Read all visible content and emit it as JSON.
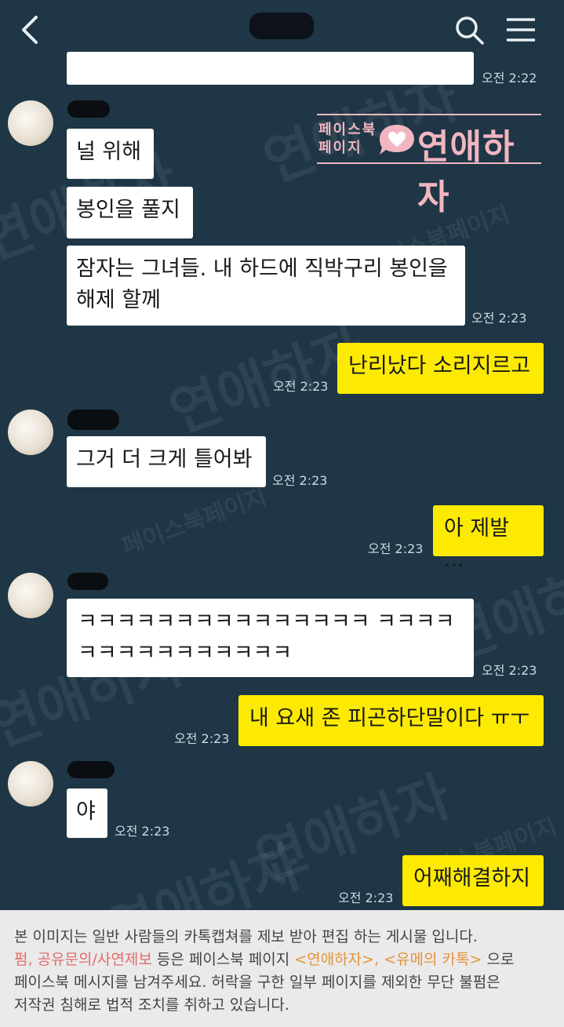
{
  "watermark": {
    "brand": "연애하자",
    "page_label": "페이스북페이지"
  },
  "topbar": {
    "back_icon": "chevron-left-icon",
    "search_icon": "search-icon",
    "menu_icon": "hamburger-icon"
  },
  "logo": {
    "top": "페이스북",
    "bottom": "페이지",
    "brand": "연애하자"
  },
  "messages": [
    {
      "time": "오전 2:22"
    },
    {
      "text": "널 위해"
    },
    {
      "text": "봉인을 풀지"
    },
    {
      "line1": "잠자는 그녀들. 내 하드에 직박구리 봉인을",
      "line2": "해제 할께",
      "time": "오전 2:23"
    },
    {
      "text": "난리났다 소리지르고",
      "time": "오전 2:23"
    },
    {
      "text": "그거 더 크게 틀어봐",
      "time": "오전 2:23"
    },
    {
      "text": "아 제발 ...",
      "time": "오전 2:23"
    },
    {
      "line1": "ㅋㅋㅋㅋㅋㅋㅋㅋㅋㅋㅋㅋㅋㅋㅋ ㅋㅋㅋㅋ",
      "line2": "ㅋㅋㅋㅋㅋㅋㅋㅋㅋㅋㅋ",
      "time": "오전 2:23"
    },
    {
      "text": "내 요새 존 피곤하단말이다 ㅠㅜ",
      "time": "오전 2:23"
    },
    {
      "text": "야",
      "time": "오전 2:23"
    },
    {
      "text": "어째해결하지",
      "time": "오전 2:23"
    }
  ],
  "footer": {
    "l1": "본 이미지는 일반 사람들의 카톡캡쳐를 제보 받아 편집 하는 게시물 입니다.",
    "l2a": "펌, 공유문의/사연제보",
    "l2b": " 등은 페이스북 페이지 ",
    "l2c": "<연애하자>, <유메의 카톡>",
    "l2d": " 으로",
    "l3": "페이스북 메시지를 남겨주세요. 허락을 구한 일부 페이지를 제외한 무단 불펌은",
    "l4": "저작권 침해로 법적 조치를 취하고 있습니다."
  }
}
